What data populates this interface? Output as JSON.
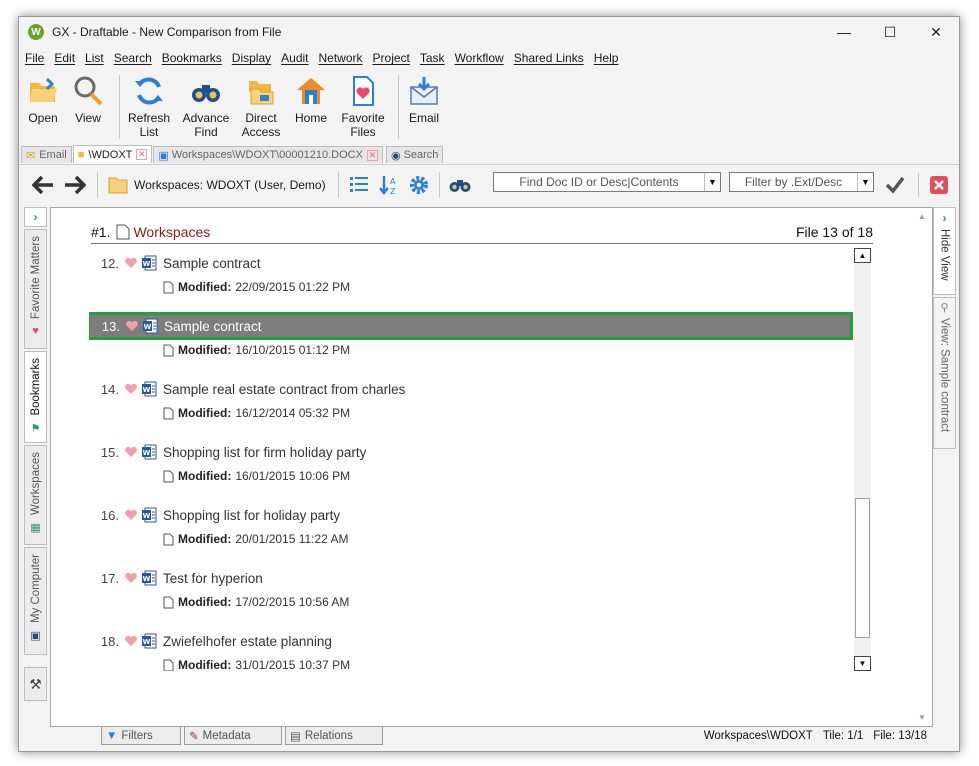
{
  "window": {
    "title": "GX - Draftable - New Comparison from File",
    "app_icon_letter": "W"
  },
  "menu": [
    "File",
    "Edit",
    "List",
    "Search",
    "Bookmarks",
    "Display",
    "Audit",
    "Network",
    "Project",
    "Task",
    "Workflow",
    "Shared Links",
    "Help"
  ],
  "toolbar": {
    "open": "Open",
    "view": "View",
    "refresh_1": "Refresh",
    "refresh_2": "List",
    "advance_1": "Advance",
    "advance_2": "Find",
    "direct_1": "Direct",
    "direct_2": "Access",
    "home": "Home",
    "fav_1": "Favorite",
    "fav_2": "Files",
    "email": "Email"
  },
  "tabs": [
    "Email",
    "\\WDOXT",
    "Workspaces\\WDOXT\\00001210.DOCX",
    "Search"
  ],
  "nav": {
    "location": "Workspaces: WDOXT (User, Demo)",
    "find_placeholder": "Find Doc ID or Desc|Contents",
    "filter_placeholder": "Filter by .Ext/Desc"
  },
  "left_tabs": [
    "Favorite Matters",
    "Bookmarks",
    "Workspaces",
    "My Computer"
  ],
  "right_tabs": [
    "Hide View",
    "View: Sample contract"
  ],
  "list_header": {
    "number": "#1.",
    "title": "Workspaces",
    "count": "File 13 of 18"
  },
  "modified_label": "Modified:",
  "rows": [
    {
      "num": "12.",
      "title": "Sample contract",
      "modified": "22/09/2015 01:22 PM"
    },
    {
      "num": "13.",
      "title": "Sample contract",
      "modified": "16/10/2015 01:12 PM"
    },
    {
      "num": "14.",
      "title": "Sample real estate contract from charles",
      "modified": "16/12/2014 05:32 PM"
    },
    {
      "num": "15.",
      "title": "Shopping list for firm holiday party",
      "modified": "16/01/2015 10:06 PM"
    },
    {
      "num": "16.",
      "title": "Shopping list for holiday party",
      "modified": "20/01/2015 11:22 AM"
    },
    {
      "num": "17.",
      "title": "Test for hyperion",
      "modified": "17/02/2015 10:56 AM"
    },
    {
      "num": "18.",
      "title": "Zwiefelhofer estate planning",
      "modified": "31/01/2015 10:37 PM"
    }
  ],
  "selected_index": 1,
  "bottom_tabs": [
    "Filters",
    "Metadata",
    "Relations"
  ],
  "status": {
    "path": "Workspaces\\WDOXT",
    "tile": "Tile: 1/1",
    "file": "File: 13/18"
  },
  "colors": {
    "accent_red": "#8b1a1a",
    "selection_green": "#23a03a",
    "selected_row": "#7d7d7d",
    "heart": "#f2a0a8",
    "word_blue": "#2b579a"
  }
}
